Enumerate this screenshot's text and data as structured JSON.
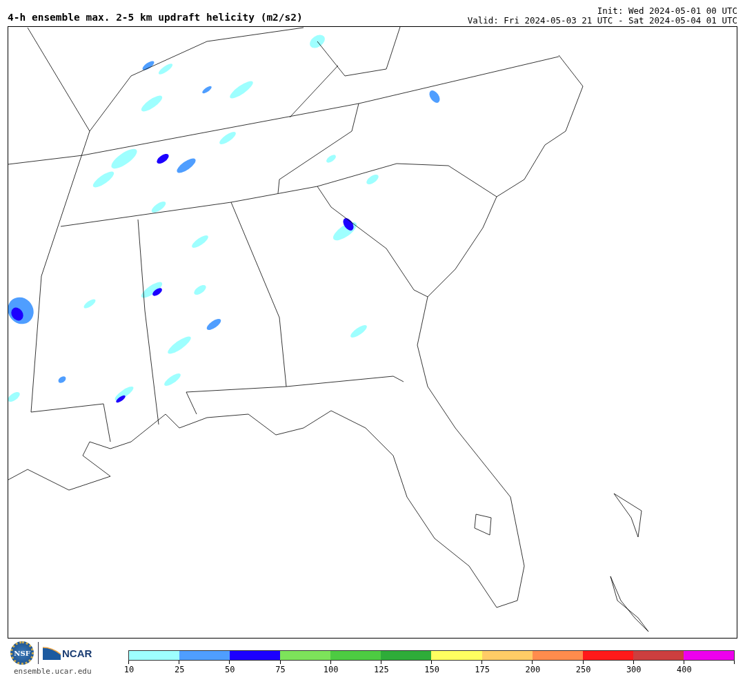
{
  "title": "4-h ensemble max. 2-5 km updraft helicity (m2/s2)",
  "init": "Init: Wed 2024-05-01 00 UTC",
  "valid": "Valid: Fri 2024-05-03 21 UTC - Sat 2024-05-04 01 UTC",
  "logo": {
    "nsf": "NSF",
    "ncar": "NCAR",
    "url": "ensemble.ucar.edu"
  },
  "colorbar": [
    {
      "label": "10",
      "color": "#9effff"
    },
    {
      "label": "25",
      "color": "#4f9eff"
    },
    {
      "label": "50",
      "color": "#1c00ff"
    },
    {
      "label": "75",
      "color": "#7de35a"
    },
    {
      "label": "100",
      "color": "#4dcb42"
    },
    {
      "label": "125",
      "color": "#2eac39"
    },
    {
      "label": "150",
      "color": "#ffff60"
    },
    {
      "label": "175",
      "color": "#ffcc66"
    },
    {
      "label": "200",
      "color": "#ff8c4d"
    },
    {
      "label": "250",
      "color": "#ff1a1a"
    },
    {
      "label": "300",
      "color": "#cc3f3f"
    },
    {
      "label": "400",
      "color": "#ee00ee"
    }
  ]
}
